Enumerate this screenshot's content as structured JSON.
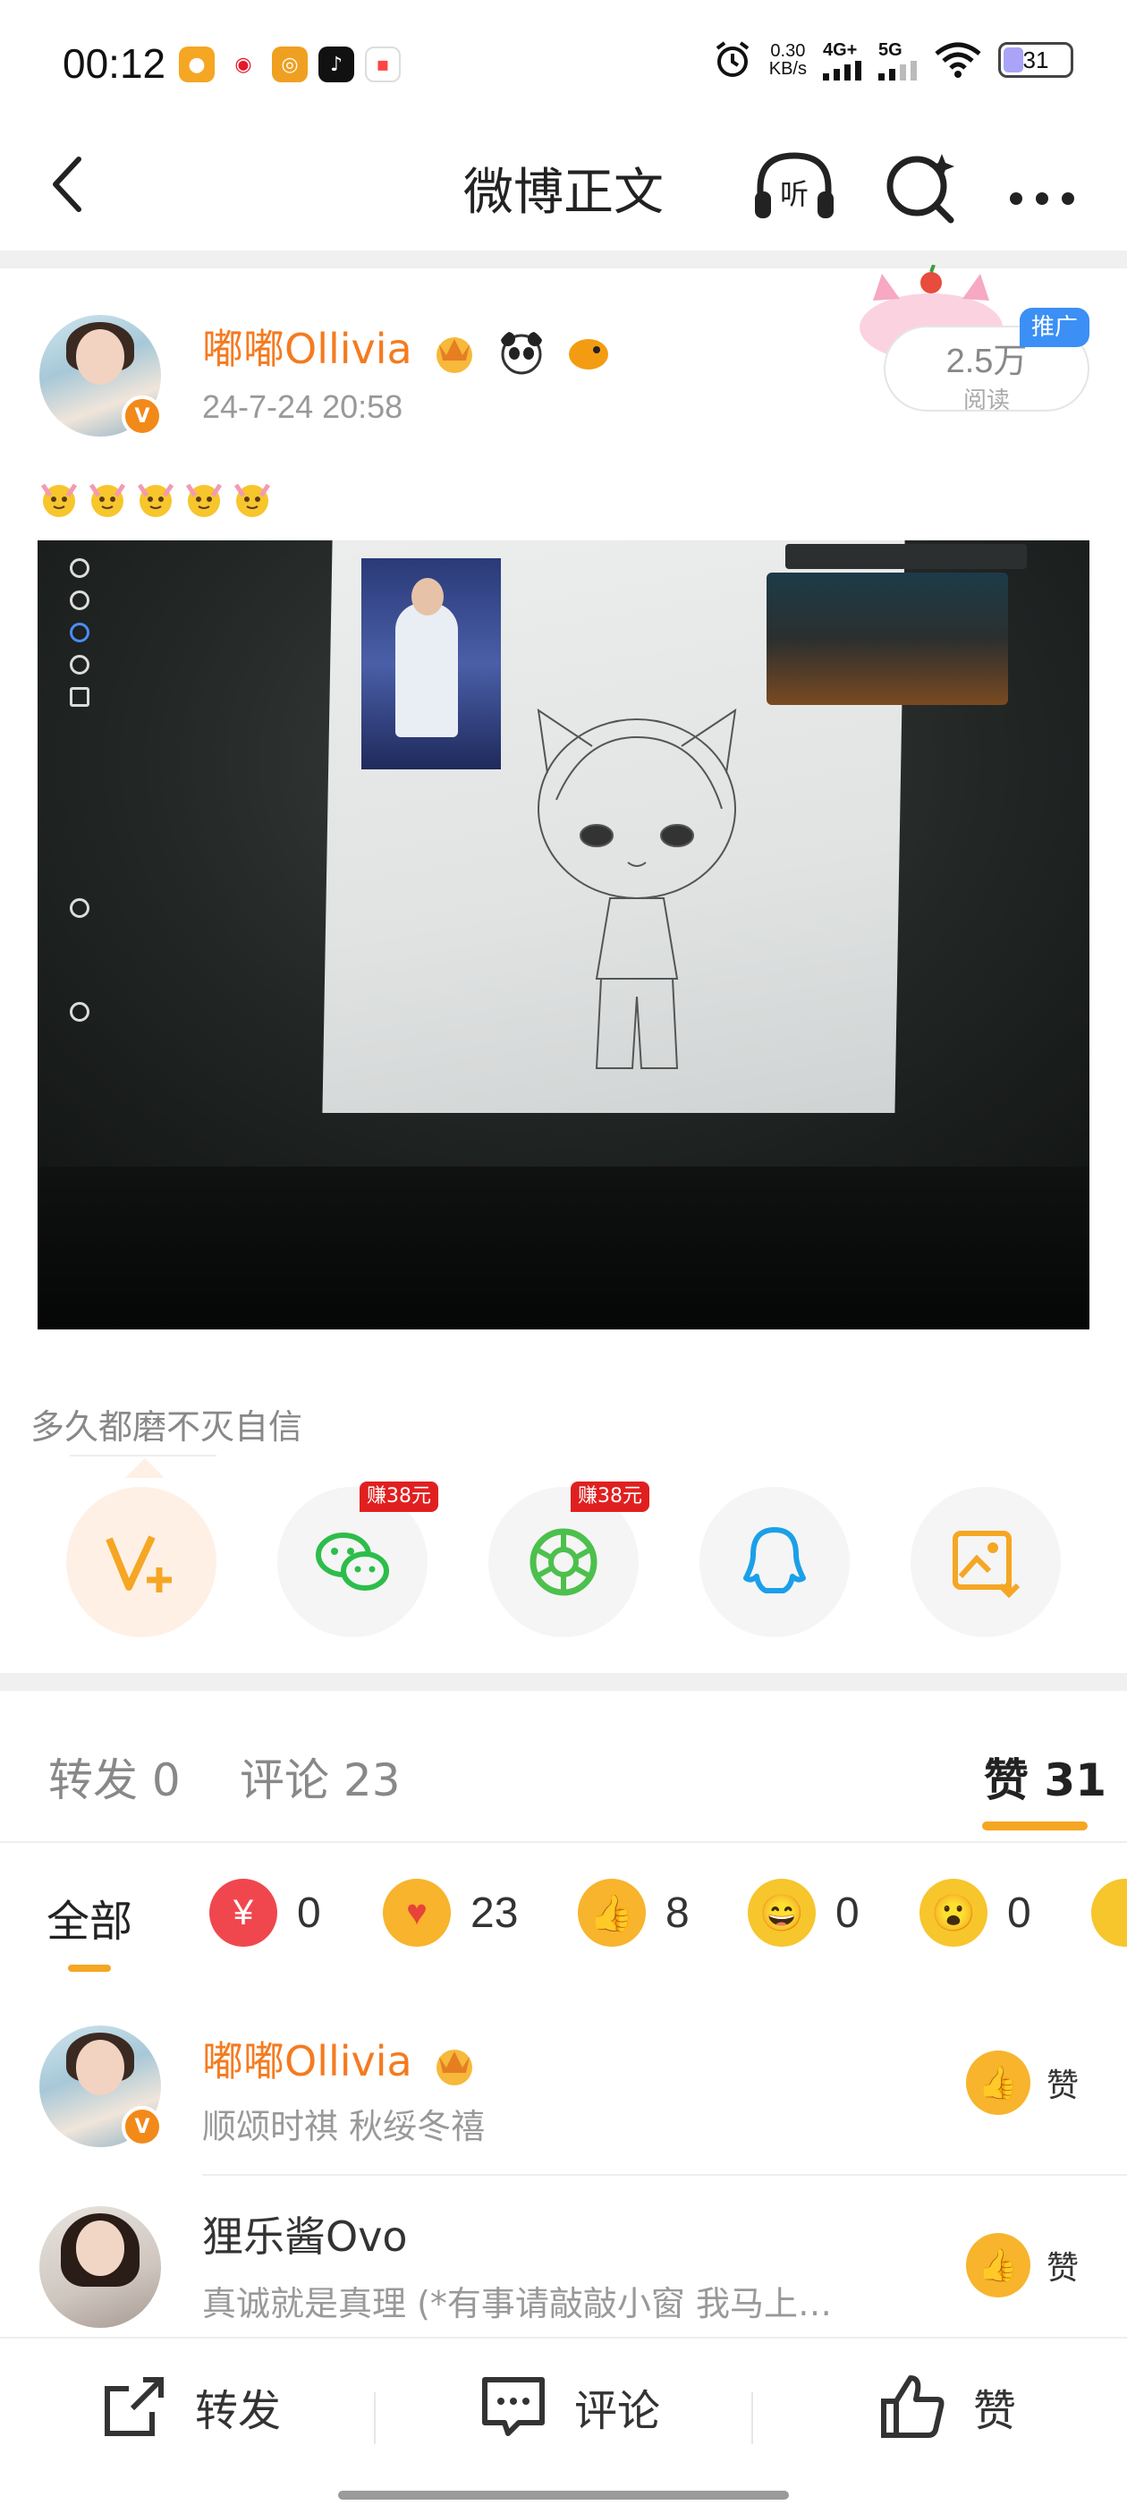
{
  "status_bar": {
    "time": "00:12",
    "net_speed_value": "0.30",
    "net_speed_unit": "KB/s",
    "signal1": "4G+",
    "signal2": "5G",
    "battery": "31",
    "battery_level_percent": 31
  },
  "nav": {
    "title": "微博正文",
    "listen_icon_text": "听"
  },
  "post": {
    "author": "嘟嘟Ollivia",
    "time": "24-7-24 20:58",
    "read_count": "2.5万",
    "read_label": "阅读",
    "promo_tag": "推广",
    "caption": "多久都磨不灭自信",
    "emoji_count": 5
  },
  "share": {
    "items": [
      {
        "name": "weibo-vplus",
        "earn": ""
      },
      {
        "name": "wechat",
        "earn": "赚38元"
      },
      {
        "name": "moments",
        "earn": "赚38元"
      },
      {
        "name": "qq",
        "earn": ""
      },
      {
        "name": "save-image",
        "earn": ""
      }
    ],
    "colors": {
      "weibo": "#f5a623",
      "wechat": "#2dbd4a",
      "qq": "#1aa0e8"
    }
  },
  "tabs": {
    "repost": "转发 0",
    "comment": "评论 23",
    "like": "赞 31"
  },
  "reactions": {
    "all": "全部",
    "counts": [
      "0",
      "23",
      "8",
      "0",
      "0"
    ]
  },
  "likes": [
    {
      "name": "嘟嘟Ollivia",
      "sub": "顺颂时祺 秋绥冬禧",
      "like_label": "赞"
    },
    {
      "name": "狸乐酱Ovo",
      "sub": "真诚就是真理 (*有事请敲敲小窗 我马上…",
      "like_label": "赞"
    }
  ],
  "bottom_bar": {
    "repost": "转发",
    "comment": "评论",
    "like": "赞"
  },
  "colors": {
    "accent_orange": "#f47b20",
    "tab_underline": "#f5a623",
    "earn_red": "#e02020",
    "promo_blue": "#3b8ff5"
  }
}
